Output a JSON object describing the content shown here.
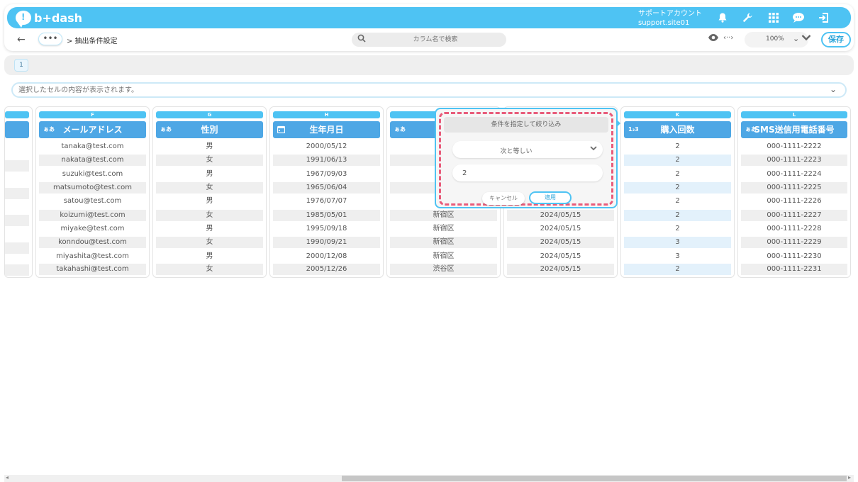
{
  "header": {
    "logo_text": "b+dash",
    "account_label": "サポートアカウント",
    "account_id": "support.site01",
    "icons": [
      "bell-icon",
      "wrench-icon",
      "apps-grid-icon",
      "chat-icon",
      "logout-icon"
    ]
  },
  "toolbar": {
    "back_icon": "←",
    "dots_label": "•••",
    "breadcrumb": "> 抽出条件設定",
    "search_placeholder": "カラム名で検索",
    "zoom_value": "100%",
    "save_label": "保存"
  },
  "pagination": {
    "current_page": "1"
  },
  "cell_bar": {
    "placeholder": "選択したセルの内容が表示されます。"
  },
  "columns": [
    {
      "letter": "F",
      "title": "メールアドレス",
      "type_icon": "ぁあ",
      "rows": [
        "tanaka@test.com",
        "nakata@test.com",
        "suzuki@test.com",
        "matsumoto@test.com",
        "satou@test.com",
        "koizumi@test.com",
        "miyake@test.com",
        "konndou@test.com",
        "miyashita@test.com",
        "takahashi@test.com"
      ]
    },
    {
      "letter": "G",
      "title": "性別",
      "type_icon": "ぁあ",
      "rows": [
        "男",
        "女",
        "男",
        "女",
        "男",
        "女",
        "男",
        "女",
        "男",
        "女"
      ]
    },
    {
      "letter": "H",
      "title": "生年月日",
      "type_icon": "📅",
      "rows": [
        "2000/05/12",
        "1991/06/13",
        "1967/09/03",
        "1965/06/04",
        "1976/07/07",
        "1985/05/01",
        "1995/09/18",
        "1990/09/21",
        "2000/12/08",
        "2005/12/26"
      ]
    },
    {
      "letter": "",
      "title": "",
      "type_icon": "ぁあ",
      "rows": [
        "",
        "",
        "新",
        "新",
        "新",
        "新宿区",
        "新宿区",
        "新宿区",
        "新宿区",
        "渋谷区"
      ]
    },
    {
      "letter": "",
      "title": "",
      "type_icon": "",
      "rows": [
        "",
        "",
        "",
        "",
        "",
        "2024/05/15",
        "2024/05/15",
        "2024/05/15",
        "2024/05/15",
        "2024/05/15"
      ]
    },
    {
      "letter": "K",
      "title": "購入回数",
      "type_icon": "1₂3",
      "rows": [
        "2",
        "2",
        "2",
        "2",
        "2",
        "2",
        "2",
        "3",
        "3",
        "2"
      ]
    },
    {
      "letter": "L",
      "title": "SMS送信用電話番号",
      "type_icon": "ぁあ",
      "rows": [
        "000-1111-2222",
        "000-1111-2223",
        "000-1111-2224",
        "000-1111-2225",
        "000-1111-2226",
        "000-1111-2227",
        "000-1111-2228",
        "000-1111-2229",
        "000-1111-2230",
        "000-1111-2231"
      ]
    }
  ],
  "filter_popup": {
    "title": "条件を指定して絞り込み",
    "operator": "次と等しい",
    "value": "2",
    "cancel_label": "キャンセル",
    "apply_label": "適用"
  },
  "colors": {
    "accent": "#4ec3f3",
    "header_blue": "#4ea7e5",
    "dashed_highlight": "#e85b7a"
  }
}
